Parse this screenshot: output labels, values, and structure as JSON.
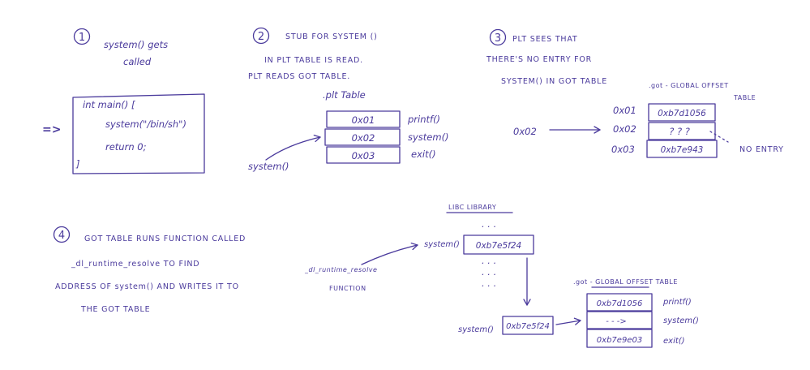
{
  "step1": {
    "number": "1",
    "line1": "system() gets",
    "line2": "called",
    "arrow": "=>",
    "code": [
      "int main() [",
      "system(\"/bin/sh\")",
      "return 0;",
      "]"
    ]
  },
  "step2": {
    "number": "2",
    "line1": "STUB FOR SYSTEM ()",
    "line2": "IN PLT TABLE IS READ.",
    "line3": "PLT READS GOT TABLE.",
    "table_title": ".plt Table",
    "entries": [
      {
        "addr": "0x01",
        "label": "printf()"
      },
      {
        "addr": "0x02",
        "label": "system()"
      },
      {
        "addr": "0x03",
        "label": "exit()"
      }
    ],
    "caller": "system()"
  },
  "step3": {
    "number": "3",
    "line1": "PLT SEES THAT",
    "line2": "THERE'S NO ENTRY FOR",
    "line3": "SYSTEM() IN GOT TABLE",
    "table_title_1": ".got - GLOBAL OFFSET",
    "table_title_2": "TABLE",
    "input": "0x02",
    "entries": [
      {
        "index": "0x01",
        "value": "0xb7d1056"
      },
      {
        "index": "0x02",
        "value": "? ? ?"
      },
      {
        "index": "0x03",
        "value": "0xb7e943"
      }
    ],
    "note": "NO ENTRY"
  },
  "step4": {
    "number": "4",
    "line1": "GOT TABLE RUNS FUNCTION CALLED",
    "line2": "_dl_runtime_resolve  TO FIND",
    "line3": "ADDRESS OF system() AND WRITES IT TO",
    "line4": "THE GOT TABLE",
    "resolver_1": "_dl_runtime_resolve",
    "resolver_2": "FUNCTION",
    "libc_title": "LIBC LIBRARY",
    "libc_label": "system()",
    "libc_addr": "0xb7e5f24",
    "dots": ". . .",
    "result_label": "system()",
    "result_addr": "0xb7e5f24",
    "got_title": ".got - GLOBAL OFFSET TABLE",
    "got_rows": [
      {
        "value": "0xb7d1056",
        "label": "printf()"
      },
      {
        "value": "- - ->",
        "label": "system()"
      },
      {
        "value": "0xb7e9e03",
        "label": "exit()"
      }
    ]
  }
}
